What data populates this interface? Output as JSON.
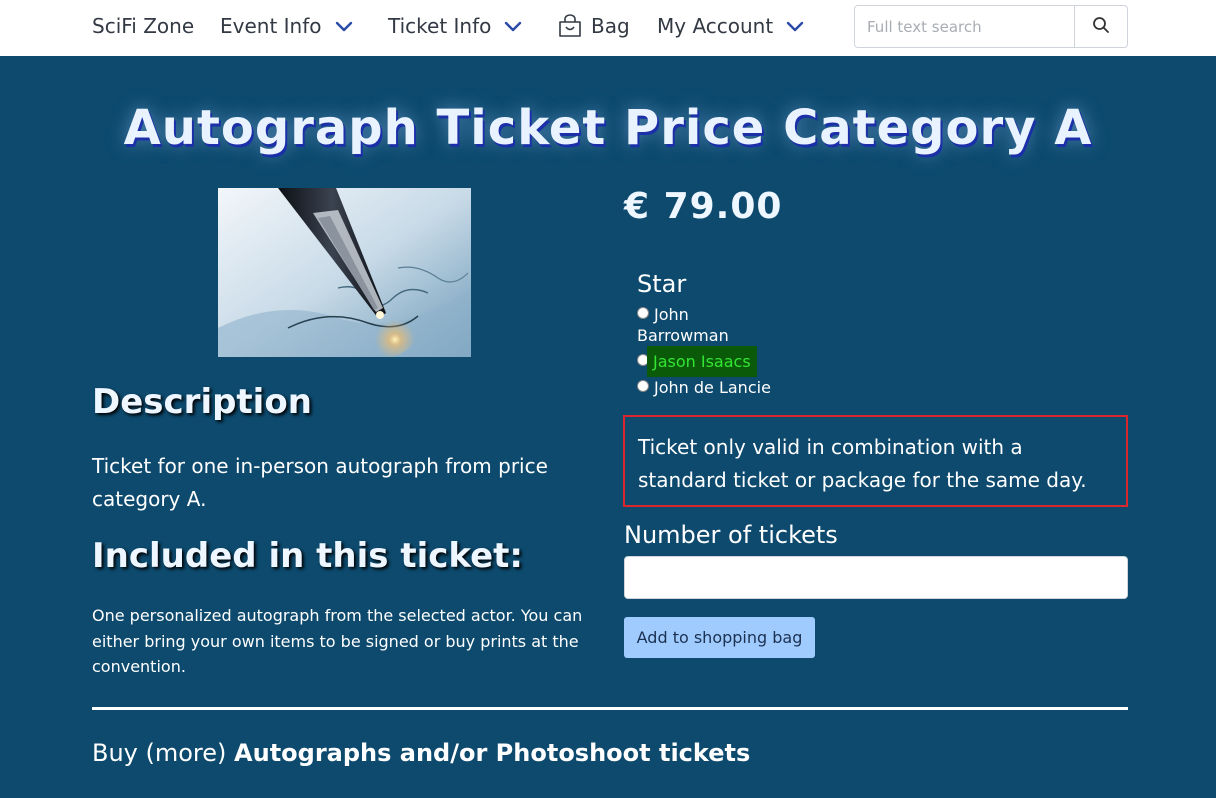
{
  "nav": {
    "brand": "SciFi Zone",
    "event_info": "Event Info",
    "ticket_info": "Ticket Info",
    "bag": "Bag",
    "my_account": "My Account",
    "search_placeholder": "Full text search"
  },
  "product": {
    "title": "Autograph Ticket Price Category A",
    "price": "€ 79.00",
    "description_heading": "Description",
    "description": "Ticket for one in-person autograph from price category A.",
    "included_heading": "Included in this ticket:",
    "included_text": "One personalized autograph from the selected actor. You can either bring your own items to be signed or buy prints at the convention."
  },
  "star_select": {
    "label": "Star",
    "options": [
      {
        "line1": "John",
        "line2": "Barrowman"
      },
      {
        "label": "Jason Isaacs"
      },
      {
        "label": "John de Lancie"
      }
    ]
  },
  "notice": "Ticket only valid in combination with a standard ticket or package for the same day.",
  "quantity": {
    "label": "Number of tickets",
    "value": ""
  },
  "add_button": "Add to shopping bag",
  "footer": {
    "buy_more_prefix": "Buy (more) ",
    "buy_more_bold": "Autographs and/or Photoshoot tickets"
  },
  "colors": {
    "background": "#0d4a6e",
    "navbar": "#ffffff",
    "notice_border": "#d9272e",
    "button": "#9fcbff",
    "highlight_bg": "#0a5a0a",
    "highlight_text": "#33e533"
  },
  "icons": [
    "chevron-down-icon",
    "shopping-bag-icon",
    "search-icon"
  ]
}
